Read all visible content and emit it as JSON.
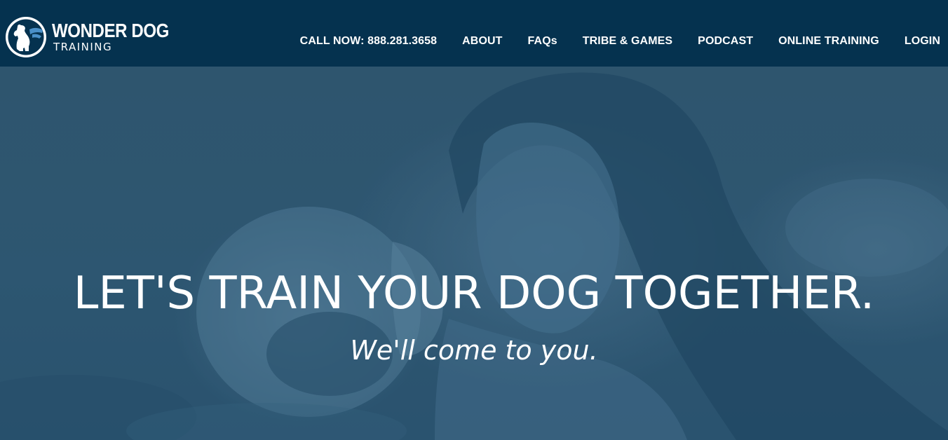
{
  "brand": {
    "name": "WONDER DOG",
    "tagline": "TRAINING",
    "logo_icon": "dog-silhouette-icon",
    "colors": {
      "header_bg": "#05324f",
      "hero_overlay": "#2e5672",
      "text": "#ffffff",
      "accent": "#4a90c8"
    }
  },
  "nav": {
    "items": [
      {
        "label": "CALL NOW: 888.281.3658"
      },
      {
        "label": "ABOUT"
      },
      {
        "label": "FAQs"
      },
      {
        "label": "TRIBE & GAMES"
      },
      {
        "label": "PODCAST"
      },
      {
        "label": "ONLINE TRAINING"
      },
      {
        "label": "LOGIN"
      }
    ]
  },
  "hero": {
    "heading": "LET'S TRAIN YOUR DOG TOGETHER.",
    "subheading": "We'll come to you."
  }
}
